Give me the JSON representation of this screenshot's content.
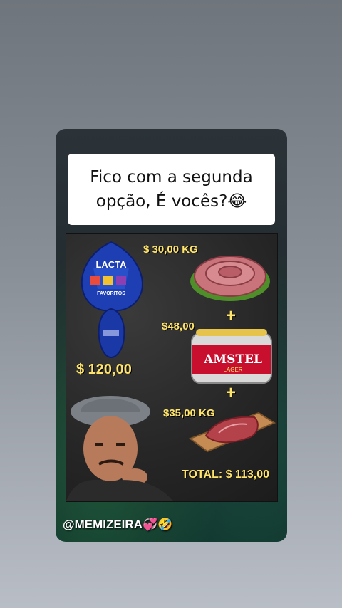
{
  "post": {
    "caption_line1": "Fico com a segunda",
    "caption_line2": "opção, É vocês?😂",
    "watermark": "@MEMIZEIRA💞🤣"
  },
  "meme": {
    "egg_price": "$ 120,00",
    "sausage_price": "$ 30,00 KG",
    "beer_price": "$48,00",
    "meat_price": "$35,00 KG",
    "total": "TOTAL: $ 113,00",
    "plus_1": "+",
    "plus_2": "+",
    "egg_brand": "LACTA",
    "egg_label": "FAVORITOS",
    "beer_brand": "AMSTEL",
    "beer_label": "LAGER"
  },
  "colors": {
    "price_text": "#ffe46b",
    "egg_wrapper": "#1e3fb3",
    "sausage": "#c9737a",
    "beer_can": "#c8102e",
    "meat": "#b4424a"
  }
}
